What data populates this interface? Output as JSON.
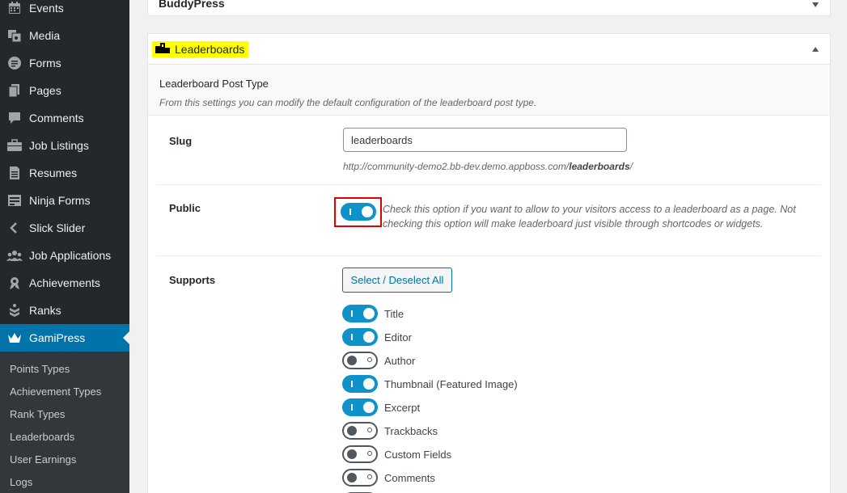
{
  "sidebar": {
    "items": [
      {
        "label": "Events",
        "icon": "calendar-icon"
      },
      {
        "label": "Media",
        "icon": "media-icon"
      },
      {
        "label": "Forms",
        "icon": "forms-icon"
      },
      {
        "label": "Pages",
        "icon": "pages-icon"
      },
      {
        "label": "Comments",
        "icon": "comments-icon"
      },
      {
        "label": "Job Listings",
        "icon": "briefcase-icon"
      },
      {
        "label": "Resumes",
        "icon": "resume-icon"
      },
      {
        "label": "Ninja Forms",
        "icon": "ninja-forms-icon"
      },
      {
        "label": "Slick Slider",
        "icon": "slider-icon"
      },
      {
        "label": "Job Applications",
        "icon": "groups-icon"
      },
      {
        "label": "Achievements",
        "icon": "award-icon"
      },
      {
        "label": "Ranks",
        "icon": "ranks-icon"
      },
      {
        "label": "GamiPress",
        "icon": "crown-icon"
      }
    ],
    "submenu": [
      "Points Types",
      "Achievement Types",
      "Rank Types",
      "Leaderboards",
      "User Earnings",
      "Logs"
    ]
  },
  "panels": {
    "buddypress_title": "BuddyPress",
    "leaderboards_title": "Leaderboards",
    "section_title": "Leaderboard Post Type",
    "section_desc": "From this settings you can modify the default configuration of the leaderboard post type."
  },
  "slug": {
    "label": "Slug",
    "value": "leaderboards",
    "url_prefix": "http://community-demo2.bb-dev.demo.appboss.com/",
    "url_slug": "leaderboards",
    "url_suffix": "/"
  },
  "public": {
    "label": "Public",
    "enabled": true,
    "desc": "Check this option if you want to allow to your visitors access to a leaderboard as a page. Not checking this option will make leaderboard just visible through shortcodes or widgets."
  },
  "supports": {
    "label": "Supports",
    "select_all": "Select / Deselect All",
    "items": [
      {
        "label": "Title",
        "on": true
      },
      {
        "label": "Editor",
        "on": true
      },
      {
        "label": "Author",
        "on": false
      },
      {
        "label": "Thumbnail (Featured Image)",
        "on": true
      },
      {
        "label": "Excerpt",
        "on": true
      },
      {
        "label": "Trackbacks",
        "on": false
      },
      {
        "label": "Custom Fields",
        "on": false
      },
      {
        "label": "Comments",
        "on": false
      }
    ]
  },
  "colors": {
    "accent": "#0073aa",
    "toggle_on": "#0e92c9",
    "highlight": "#ffff00",
    "focus_box": "#e00000"
  }
}
